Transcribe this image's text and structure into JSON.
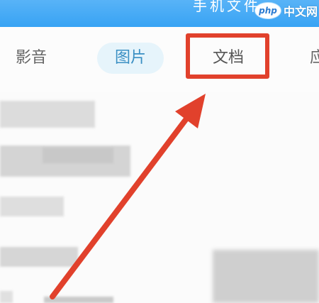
{
  "header": {
    "title": "手机文件",
    "watermark_logo": "php",
    "watermark_text": "中文网"
  },
  "tabs": [
    {
      "label": "影音",
      "selected": false
    },
    {
      "label": "图片",
      "selected": true
    },
    {
      "label": "文档",
      "selected": false,
      "highlighted": true
    },
    {
      "label": "应",
      "selected": false
    }
  ],
  "colors": {
    "header_blue": "#38a3f4",
    "selected_tab_bg": "#e6f4fb",
    "annotation_red": "#e1412c"
  }
}
